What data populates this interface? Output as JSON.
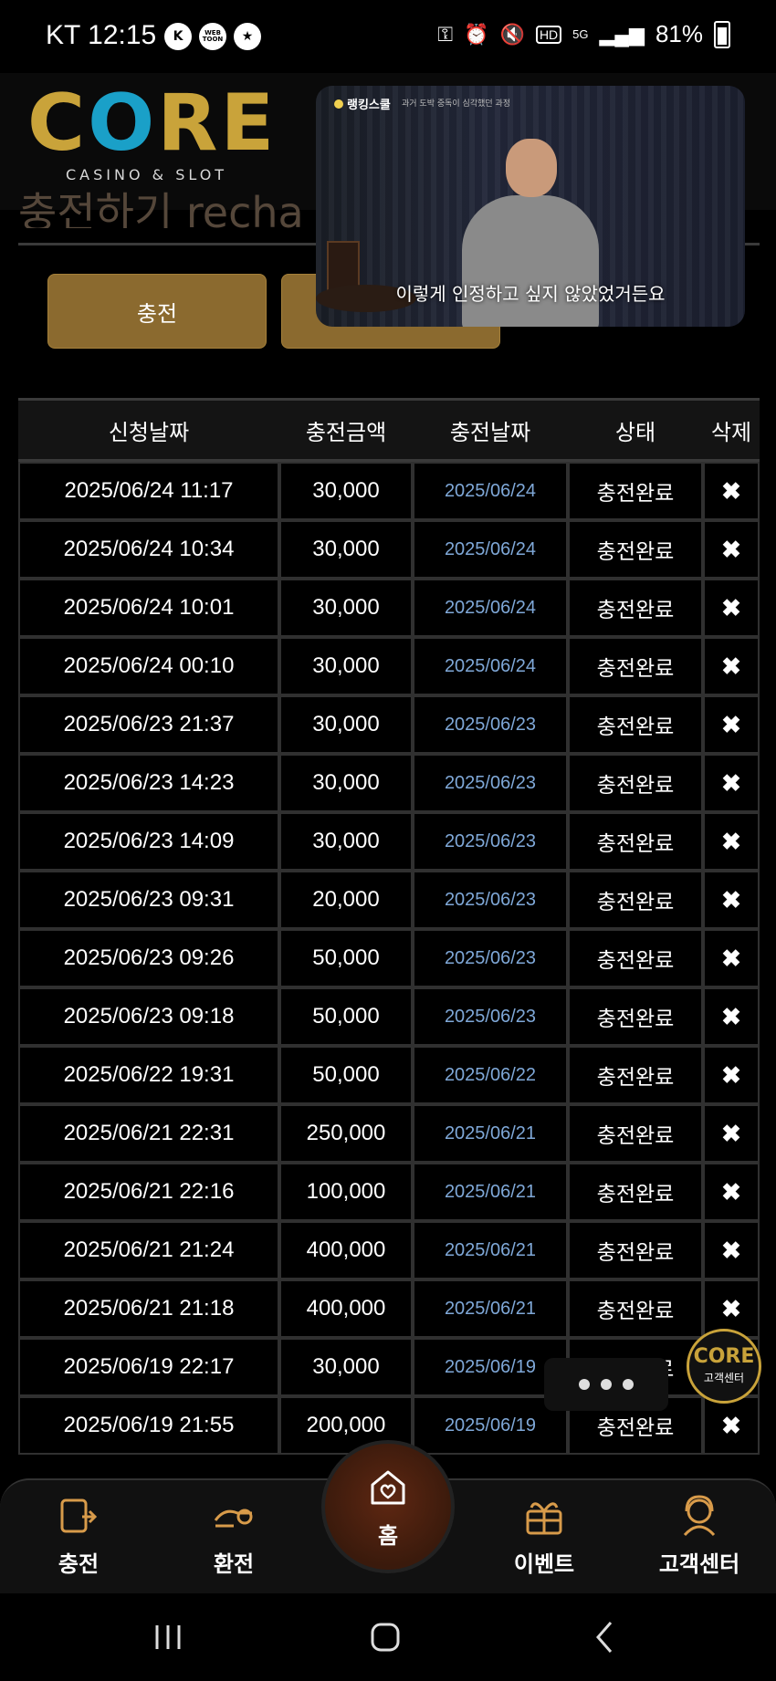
{
  "status_bar": {
    "carrier_time": "KT 12:15",
    "app_icons": [
      "K",
      "WEB TOON",
      "★"
    ],
    "indicators": [
      "key-icon",
      "alarm-icon",
      "mute-icon",
      "HD",
      "5G",
      "signal-icon"
    ],
    "battery": "81%"
  },
  "header": {
    "logo_text": "CORE",
    "logo_subtitle": "CASINO & SLOT",
    "partial_title": "충전하기 recha"
  },
  "tabs": {
    "charge_label": "충전"
  },
  "video": {
    "channel": "랭킹스쿨",
    "caption_small": "과거 도박 중독이 심각했던 과정",
    "subtitle": "이렇게 인정하고 싶지 않았었거든요"
  },
  "table": {
    "headers": [
      "신청날짜",
      "충전금액",
      "충전날짜",
      "상태",
      "삭제"
    ],
    "rows": [
      {
        "requested": "2025/06/24 11:17",
        "amount": "30,000",
        "charged": "2025/06/24",
        "status": "충전완료",
        "del": "✖"
      },
      {
        "requested": "2025/06/24 10:34",
        "amount": "30,000",
        "charged": "2025/06/24",
        "status": "충전완료",
        "del": "✖"
      },
      {
        "requested": "2025/06/24 10:01",
        "amount": "30,000",
        "charged": "2025/06/24",
        "status": "충전완료",
        "del": "✖"
      },
      {
        "requested": "2025/06/24 00:10",
        "amount": "30,000",
        "charged": "2025/06/24",
        "status": "충전완료",
        "del": "✖"
      },
      {
        "requested": "2025/06/23 21:37",
        "amount": "30,000",
        "charged": "2025/06/23",
        "status": "충전완료",
        "del": "✖"
      },
      {
        "requested": "2025/06/23 14:23",
        "amount": "30,000",
        "charged": "2025/06/23",
        "status": "충전완료",
        "del": "✖"
      },
      {
        "requested": "2025/06/23 14:09",
        "amount": "30,000",
        "charged": "2025/06/23",
        "status": "충전완료",
        "del": "✖"
      },
      {
        "requested": "2025/06/23 09:31",
        "amount": "20,000",
        "charged": "2025/06/23",
        "status": "충전완료",
        "del": "✖"
      },
      {
        "requested": "2025/06/23 09:26",
        "amount": "50,000",
        "charged": "2025/06/23",
        "status": "충전완료",
        "del": "✖"
      },
      {
        "requested": "2025/06/23 09:18",
        "amount": "50,000",
        "charged": "2025/06/23",
        "status": "충전완료",
        "del": "✖"
      },
      {
        "requested": "2025/06/22 19:31",
        "amount": "50,000",
        "charged": "2025/06/22",
        "status": "충전완료",
        "del": "✖"
      },
      {
        "requested": "2025/06/21 22:31",
        "amount": "250,000",
        "charged": "2025/06/21",
        "status": "충전완료",
        "del": "✖"
      },
      {
        "requested": "2025/06/21 22:16",
        "amount": "100,000",
        "charged": "2025/06/21",
        "status": "충전완료",
        "del": "✖"
      },
      {
        "requested": "2025/06/21 21:24",
        "amount": "400,000",
        "charged": "2025/06/21",
        "status": "충전완료",
        "del": "✖"
      },
      {
        "requested": "2025/06/21 21:18",
        "amount": "400,000",
        "charged": "2025/06/21",
        "status": "충전완료",
        "del": "✖"
      },
      {
        "requested": "2025/06/19 22:17",
        "amount": "30,000",
        "charged": "2025/06/19",
        "status": "충전완료",
        "del": "✖"
      },
      {
        "requested": "2025/06/19 21:55",
        "amount": "200,000",
        "charged": "2025/06/19",
        "status": "충전완료",
        "del": "✖"
      }
    ]
  },
  "floating": {
    "cs_logo": "CORE",
    "cs_label": "고객센터"
  },
  "bottom_nav": {
    "items": [
      {
        "label": "충전",
        "icon": "charge-icon"
      },
      {
        "label": "환전",
        "icon": "exchange-icon"
      },
      {
        "label": "홈",
        "icon": "heart-home-icon"
      },
      {
        "label": "이벤트",
        "icon": "gift-icon"
      },
      {
        "label": "고객센터",
        "icon": "support-icon"
      }
    ]
  },
  "colors": {
    "gold": "#c9a33a",
    "button_gold": "#8b6a2f",
    "date_blue": "#7fa8d8",
    "home_bg": "#3a1a0c"
  }
}
